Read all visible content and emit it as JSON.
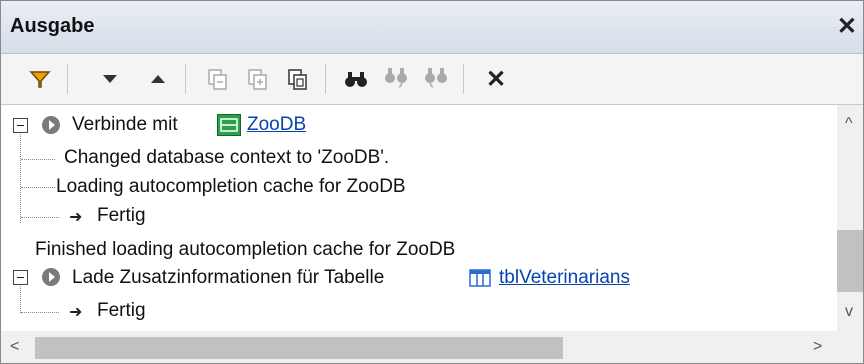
{
  "panel": {
    "title": "Ausgabe",
    "close_glyph": "✕"
  },
  "toolbar": {
    "icons": [
      "filter-icon",
      "move-down-icon",
      "move-up-icon",
      "copy-selected-icon",
      "copy-all-icon",
      "copy-to-clipboard-icon",
      "find-icon",
      "find-previous-icon",
      "find-next-icon",
      "clear-icon"
    ],
    "clear_glyph": "✕"
  },
  "output": {
    "connect_label": "Verbinde mit",
    "connect_target": "ZooDB",
    "changed_context": "Changed database context to 'ZooDB'.",
    "loading_cache": "Loading autocompletion cache for ZooDB",
    "done_1": "Fertig",
    "finished_loading": "Finished loading autocompletion cache for ZooDB",
    "load_info_label": "Lade Zusatzinformationen für Tabelle",
    "table_link": "tblVeterinarians",
    "done_2": "Fertig"
  },
  "scroll": {
    "up": "^",
    "down": "v",
    "left": "<",
    "right": ">"
  },
  "colors": {
    "filter": "#f0a000",
    "db_icon": "#2aa14a",
    "table_icon": "#2a6ed1",
    "link": "#0645ad"
  }
}
